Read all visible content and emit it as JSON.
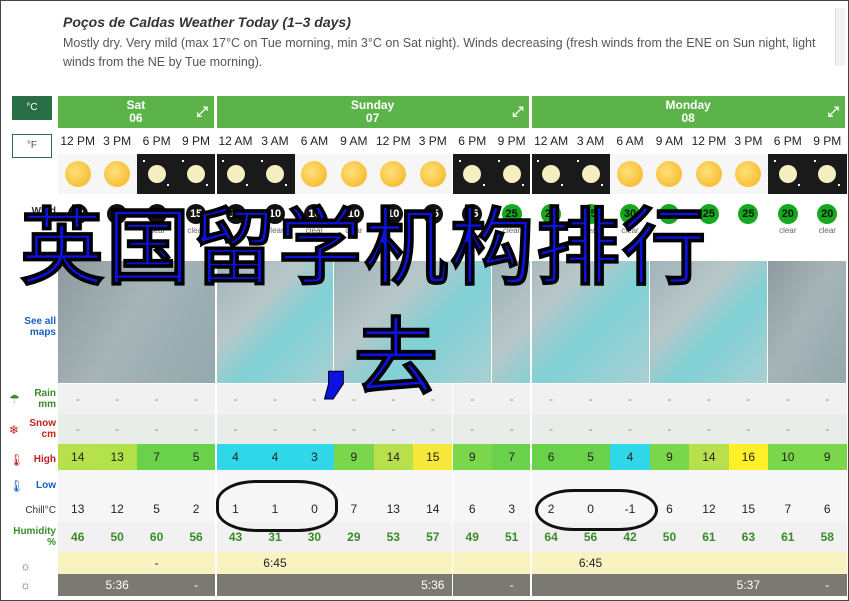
{
  "header": {
    "title": "Poços de Caldas Weather Today (1–3 days)",
    "description": "Mostly dry. Very mild (max 17°C on Tue morning, min 3°C on Sat night). Winds decreasing (fresh winds from the ENE on Sun night, light winds from the NE by Tue morning)."
  },
  "units": {
    "celsius": "°C",
    "fahrenheit": "°F"
  },
  "sidebar": {
    "wind": "Wind",
    "see_all_maps": "See all maps",
    "rain": "Rain mm",
    "snow": "Snow cm",
    "high": "High",
    "low": "Low",
    "chill": "Chill°C",
    "humidity": "Humidity %"
  },
  "days": [
    {
      "name": "Sat",
      "date": "06"
    },
    {
      "name": "Sunday",
      "date": "07"
    },
    {
      "name": "Monday",
      "date": "08"
    }
  ],
  "times": [
    "12 PM",
    "3 PM",
    "6 PM",
    "9 PM",
    "12 AM",
    "3 AM",
    "6 AM",
    "9 AM",
    "12 PM",
    "3 PM",
    "6 PM",
    "9 PM",
    "12 AM",
    "3 AM",
    "6 AM",
    "9 AM",
    "12 PM",
    "3 PM",
    "6 PM",
    "9 PM"
  ],
  "wind": [
    "10",
    "15",
    "15",
    "15",
    "10",
    "10",
    "10",
    "10",
    "10",
    "15",
    "15",
    "25",
    "25",
    "25",
    "30",
    "25",
    "25",
    "25",
    "20",
    "20"
  ],
  "wind_text": [
    "",
    "",
    "clear",
    "clear",
    "",
    "clear",
    "clear",
    "clear",
    "",
    "",
    "",
    "clear",
    "",
    "clear",
    "clear",
    "",
    "",
    "",
    "clear",
    "clear"
  ],
  "rain": [
    "-",
    "-",
    "-",
    "-",
    "-",
    "-",
    "-",
    "-",
    "-",
    "-",
    "-",
    "-",
    "-",
    "-",
    "-",
    "-",
    "-",
    "-",
    "-",
    "-"
  ],
  "snow": [
    "-",
    "-",
    "-",
    "-",
    "-",
    "-",
    "-",
    "-",
    "-",
    "-",
    "-",
    "-",
    "-",
    "-",
    "-",
    "-",
    "-",
    "-",
    "-",
    "-"
  ],
  "high": [
    "14",
    "13",
    "7",
    "5",
    "4",
    "4",
    "3",
    "9",
    "14",
    "15",
    "9",
    "7",
    "6",
    "5",
    "4",
    "9",
    "14",
    "16",
    "10",
    "9"
  ],
  "low": [
    "",
    "",
    "",
    "",
    "",
    "",
    "",
    "",
    "",
    "",
    "",
    "",
    "",
    "",
    "",
    "",
    "",
    "",
    "",
    ""
  ],
  "chill": [
    "13",
    "12",
    "5",
    "2",
    "1",
    "1",
    "0",
    "7",
    "13",
    "14",
    "6",
    "3",
    "2",
    "0",
    "-1",
    "6",
    "12",
    "15",
    "7",
    "6"
  ],
  "humidity": [
    "46",
    "50",
    "60",
    "56",
    "43",
    "31",
    "30",
    "29",
    "53",
    "57",
    "49",
    "51",
    "64",
    "56",
    "42",
    "50",
    "61",
    "63",
    "61",
    "58"
  ],
  "sunrise": [
    "",
    "",
    "-",
    "",
    "",
    "6:45",
    "",
    "",
    "",
    "",
    "",
    "",
    "",
    "6:45",
    "",
    "",
    "",
    "",
    "",
    ""
  ],
  "sunset": [
    "",
    "5:36",
    "",
    "-",
    "",
    "",
    "",
    "",
    "",
    "5:36",
    "",
    "-",
    "",
    "",
    "",
    "",
    "",
    "5:37",
    "",
    "-"
  ],
  "overlay": {
    "line1": "英国留学机构排行",
    "line2": ",去"
  },
  "colors": {
    "day_header": "#5cb34a",
    "unit_active": "#2a6e45",
    "overlay_text": "#0c12e0"
  }
}
